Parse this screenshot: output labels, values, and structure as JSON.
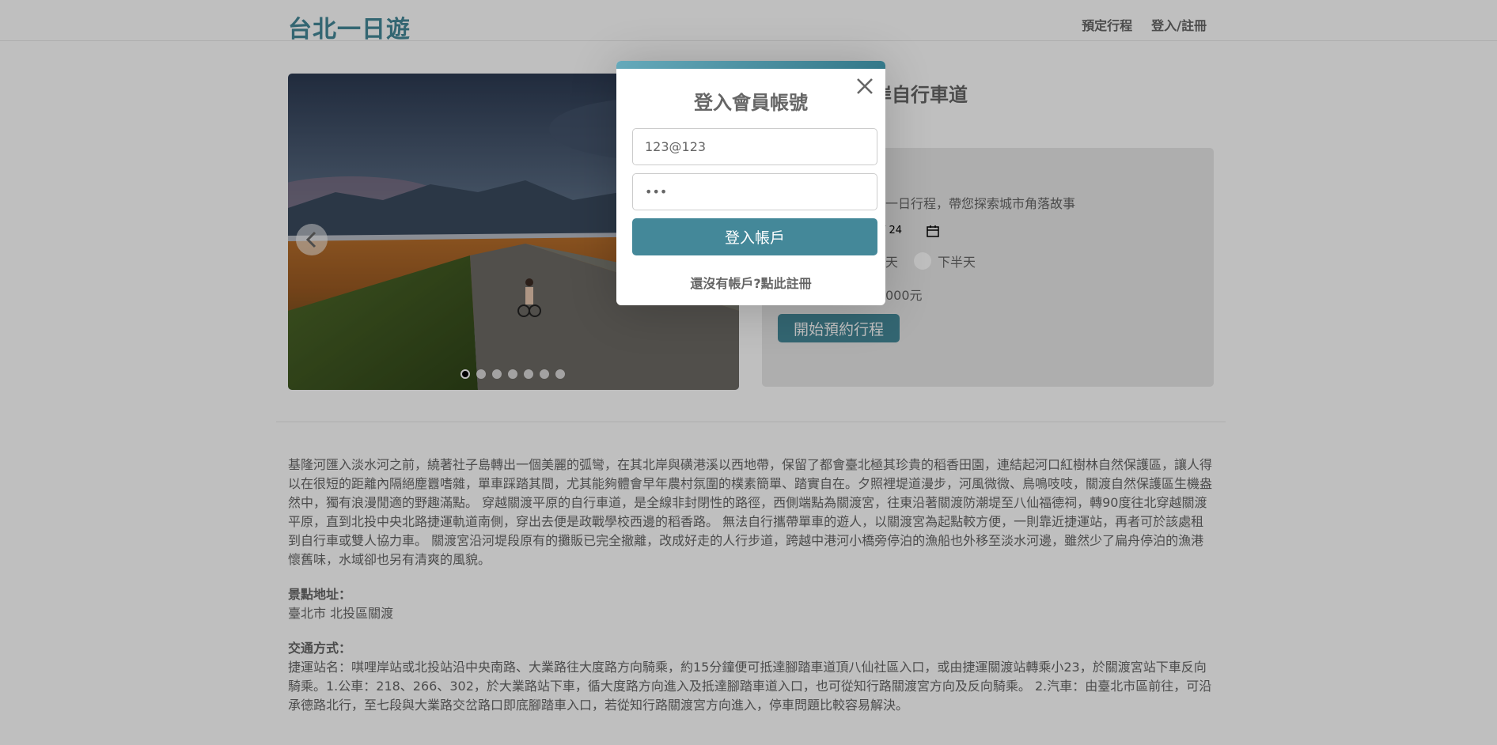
{
  "header": {
    "brand": "台北一日遊",
    "nav": [
      "預定行程",
      "登入/註冊"
    ]
  },
  "attraction": {
    "title_partial": "岸、八里左岸自行車道",
    "booking": {
      "description_partial": "一日行程，帶您探索城市角落故事",
      "date_partial": "/ 24",
      "time_option_partial": "天",
      "time_option_2": "下半天",
      "fee_partial": "000元",
      "button": "開始預約行程"
    }
  },
  "carousel": {
    "slide_count": 7,
    "active_index": 0
  },
  "content": {
    "description": "基隆河匯入淡水河之前，繞著社子島轉出一個美麗的弧彎，在其北岸與磺港溪以西地帶，保留了都會臺北極其珍貴的稻香田園，連結起河口紅樹林自然保護區，讓人得以在很短的距離內隔絕塵囂嗜雜，單車踩踏其間，尤其能夠體會早年農村氛圍的樸素簡單、踏實自在。夕照裡堤道漫步，河風微微、鳥鳴吱吱，關渡自然保護區生機盎然中，獨有浪漫閒適的野趣滿點。 穿越關渡平原的自行車道，是全線非封閉性的路徑，西側端點為關渡宮，往東沿著關渡防潮堤至八仙福德祠，轉90度往北穿越關渡平原，直到北投中央北路捷運軌道南側，穿出去便是政戰學校西邊的稻香路。 無法自行攜帶單車的遊人，以關渡宮為起點較方便，一則靠近捷運站，再者可於該處租到自行車或雙人協力車。 關渡宮沿河堤段原有的攤販已完全撤離，改成好走的人行步道，跨越中港河小橋旁停泊的漁船也外移至淡水河邊，雖然少了扁舟停泊的漁港懷舊味，水域卻也另有清爽的風貌。",
    "address_label": "景點地址：",
    "address": "臺北市 北投區關渡",
    "transport_label": "交通方式：",
    "transport": "捷運站名：唭哩岸站或北投站沿中央南路、大業路往大度路方向騎乘，約15分鐘便可抵達腳踏車道頂八仙社區入口，或由捷運關渡站轉乘小23，於關渡宮站下車反向騎乘。1.公車：218、266、302，於大業路站下車，循大度路方向進入及抵達腳踏車道入口，也可從知行路關渡宮方向及反向騎乘。 2.汽車：由臺北市區前往，可沿承德路北行，至七段與大業路交岔路口即底腳踏車入口，若從知行路關渡宮方向進入，停車問題比較容易解決。"
  },
  "modal": {
    "title": "登入會員帳號",
    "email_value": "123@123",
    "password_value": "123",
    "submit": "登入帳戶",
    "switch_text": "還沒有帳戶?點此註冊"
  },
  "colors": {
    "accent": "#448899",
    "text": "#666666",
    "panel": "#e8e8e8"
  }
}
